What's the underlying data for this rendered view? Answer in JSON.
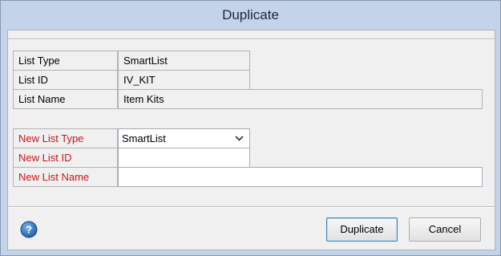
{
  "window": {
    "title": "Duplicate"
  },
  "source": {
    "list_type_label": "List Type",
    "list_type_value": "SmartList",
    "list_id_label": "List ID",
    "list_id_value": "IV_KIT",
    "list_name_label": "List Name",
    "list_name_value": "Item Kits"
  },
  "target": {
    "new_list_type_label": "New List Type",
    "new_list_type_value": "SmartList",
    "new_list_id_label": "New List ID",
    "new_list_id_value": "",
    "new_list_name_label": "New List Name",
    "new_list_name_value": ""
  },
  "buttons": {
    "duplicate_label": "Duplicate",
    "cancel_label": "Cancel"
  },
  "icons": {
    "help": "help-icon",
    "dropdown": "chevron-down-icon"
  },
  "colors": {
    "required_label": "#c8141e",
    "help_icon": "#1f5fa8",
    "title_bar": "#c3d3ea"
  }
}
